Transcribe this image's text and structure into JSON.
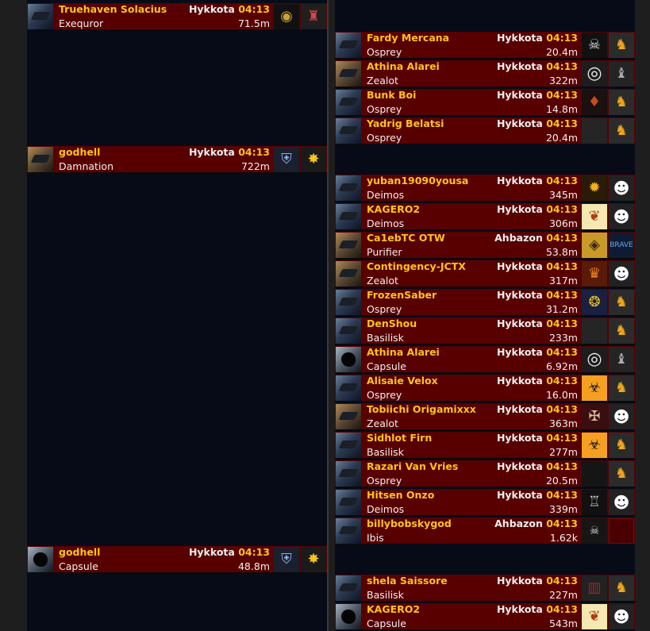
{
  "left_rows": [
    {
      "pilot": "Truehaven Solacius",
      "ship": "Exequror",
      "system": "Hykkota",
      "time": "04:13",
      "distance": "71.5m",
      "ship_icon": "gallente-ship",
      "corp_icon": "eye-logo",
      "ally_icon": "knight-logo"
    },
    {
      "pilot": "godhell",
      "ship": "Damnation",
      "system": "Hykkota",
      "time": "04:13",
      "distance": "722m",
      "ship_icon": "amarr-ship",
      "corp_icon": "shield-logo",
      "ally_icon": "bee-logo"
    },
    {
      "pilot": "godhell",
      "ship": "Capsule",
      "system": "Hykkota",
      "time": "04:13",
      "distance": "48.8m",
      "ship_icon": "capsule",
      "corp_icon": "shield-logo",
      "ally_icon": "bee-logo"
    }
  ],
  "right_rows": [
    {
      "pilot": "Fardy Mercana",
      "ship": "Osprey",
      "system": "Hykkota",
      "time": "04:13",
      "distance": "20.4m",
      "ship_icon": "caldari-ship",
      "corp_icon": "skull-robot-logo",
      "ally_icon": "duck-logo"
    },
    {
      "pilot": "Athina Alarei",
      "ship": "Zealot",
      "system": "Hykkota",
      "time": "04:13",
      "distance": "322m",
      "ship_icon": "amarr-ship",
      "corp_icon": "ring-logo",
      "ally_icon": "bust-logo"
    },
    {
      "pilot": "Bunk Boi",
      "ship": "Osprey",
      "system": "Hykkota",
      "time": "04:13",
      "distance": "14.8m",
      "ship_icon": "caldari-ship",
      "corp_icon": "red-mask-logo",
      "ally_icon": "duck-logo"
    },
    {
      "pilot": "Yadrig Belatsi",
      "ship": "Osprey",
      "system": "Hykkota",
      "time": "04:13",
      "distance": "20.4m",
      "ship_icon": "caldari-ship",
      "corp_icon": "empty-logo",
      "ally_icon": "duck-logo"
    },
    {
      "pilot": "yuban19090yousa",
      "ship": "Deimos",
      "system": "Hykkota",
      "time": "04:13",
      "distance": "345m",
      "ship_icon": "gallente-ship",
      "corp_icon": "gold-logo",
      "ally_icon": "skull-round-logo"
    },
    {
      "pilot": "KAGERO2",
      "ship": "Deimos",
      "system": "Hykkota",
      "time": "04:13",
      "distance": "306m",
      "ship_icon": "gallente-ship",
      "corp_icon": "flame-logo",
      "ally_icon": "skull-round-logo"
    },
    {
      "pilot": "Ca1ebTC OTW",
      "ship": "Purifier",
      "system": "Ahbazon",
      "time": "04:13",
      "distance": "53.8m",
      "ship_icon": "amarr-ship",
      "corp_icon": "gold-eye-logo",
      "ally_icon": "brave-logo"
    },
    {
      "pilot": "Contingency-JCTX",
      "ship": "Zealot",
      "system": "Hykkota",
      "time": "04:13",
      "distance": "317m",
      "ship_icon": "amarr-ship",
      "corp_icon": "red-crest-logo",
      "ally_icon": "skull-round-logo"
    },
    {
      "pilot": "FrozenSaber",
      "ship": "Osprey",
      "system": "Hykkota",
      "time": "04:13",
      "distance": "31.2m",
      "ship_icon": "caldari-ship",
      "corp_icon": "cog-logo",
      "ally_icon": "duck-logo"
    },
    {
      "pilot": "DenShou",
      "ship": "Basilisk",
      "system": "Hykkota",
      "time": "04:13",
      "distance": "233m",
      "ship_icon": "caldari-ship",
      "corp_icon": "empty-logo",
      "ally_icon": "duck-logo"
    },
    {
      "pilot": "Athina Alarei",
      "ship": "Capsule",
      "system": "Hykkota",
      "time": "04:13",
      "distance": "6.92m",
      "ship_icon": "capsule",
      "corp_icon": "ring-logo",
      "ally_icon": "bust-logo"
    },
    {
      "pilot": "Alisaie Velox",
      "ship": "Osprey",
      "system": "Hykkota",
      "time": "04:13",
      "distance": "16.0m",
      "ship_icon": "caldari-ship",
      "corp_icon": "biohazard-logo",
      "ally_icon": "duck-logo"
    },
    {
      "pilot": "Tobiichi Origamixxx",
      "ship": "Zealot",
      "system": "Hykkota",
      "time": "04:13",
      "distance": "363m",
      "ship_icon": "amarr-ship",
      "corp_icon": "red-skull-logo",
      "ally_icon": "skull-round-logo"
    },
    {
      "pilot": "Sidhlot Firn",
      "ship": "Basilisk",
      "system": "Hykkota",
      "time": "04:13",
      "distance": "277m",
      "ship_icon": "caldari-ship",
      "corp_icon": "biohazard-logo",
      "ally_icon": "duck-logo"
    },
    {
      "pilot": "Razari Van Vries",
      "ship": "Osprey",
      "system": "Hykkota",
      "time": "04:13",
      "distance": "20.5m",
      "ship_icon": "caldari-ship",
      "corp_icon": "dark-logo",
      "ally_icon": "duck-logo"
    },
    {
      "pilot": "Hitsen Onzo",
      "ship": "Deimos",
      "system": "Hykkota",
      "time": "04:13",
      "distance": "339m",
      "ship_icon": "gallente-ship",
      "corp_icon": "helm-logo",
      "ally_icon": "skull-round-logo"
    },
    {
      "pilot": "billybobskygod",
      "ship": "Ibis",
      "system": "Ahbazon",
      "time": "04:13",
      "distance": "1.62k",
      "ship_icon": "gallente-ship",
      "corp_icon": "cross-skull-logo",
      "ally_icon": "maroon-logo"
    },
    {
      "pilot": "shela Saissore",
      "ship": "Basilisk",
      "system": "Hykkota",
      "time": "04:13",
      "distance": "227m",
      "ship_icon": "caldari-ship",
      "corp_icon": "tower-logo",
      "ally_icon": "duck-logo"
    },
    {
      "pilot": "KAGERO2",
      "ship": "Capsule",
      "system": "Hykkota",
      "time": "04:13",
      "distance": "543m",
      "ship_icon": "capsule",
      "corp_icon": "flame-logo",
      "ally_icon": "skull-round-logo"
    }
  ]
}
